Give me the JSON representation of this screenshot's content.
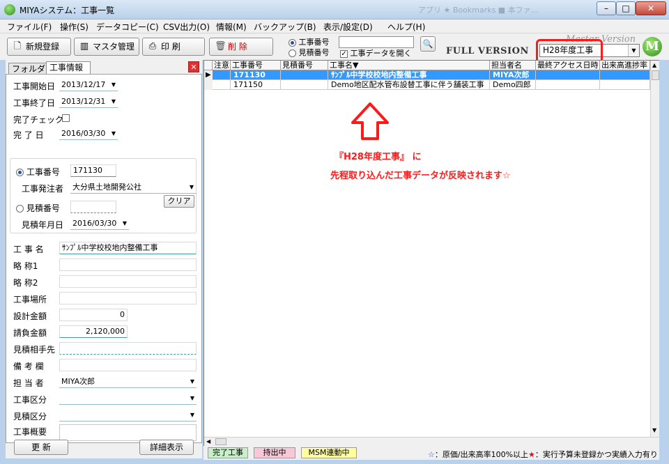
{
  "window": {
    "title": "MIYAシステム：工事一覧",
    "background_tabs": "アプリ  ★ Bookmarks  ■ 本ファ..."
  },
  "menu": [
    "ファイル(F)",
    "操作(S)",
    "データコピー(C)",
    "CSV出力(O)",
    "情報(M)",
    "バックアップ(B)",
    "表示/設定(D)",
    "ヘルプ(H)"
  ],
  "toolbar": {
    "new_label": "新規登録",
    "master_label": "マスタ管理",
    "print_label": "印 刷",
    "delete_label": "削 除",
    "radio_job_no": "工事番号",
    "radio_estimate_no": "見積番号",
    "open_data_label": "工事データを開く",
    "search_value": "",
    "full_version": "FULL VERSION",
    "master_version": "Master Version",
    "fiscal_year": "H28年度工事",
    "logo_letter": "M"
  },
  "tabs": {
    "folder": "フォルダ",
    "info": "工事情報"
  },
  "form": {
    "start_date_label": "工事開始日",
    "start_date": "2013/12/17",
    "end_date_label": "工事終了日",
    "end_date": "2013/12/31",
    "complete_check_label": "完了チェック",
    "complete_date_label": "完 了 日",
    "complete_date": "2016/03/30",
    "job_no_label": "工事番号",
    "job_no": "171130",
    "client_label": "工事発注者",
    "client": "大分県土地開発公社",
    "estimate_no_label": "見積番号",
    "estimate_no": "",
    "clear_label": "クリア",
    "estimate_date_label": "見積年月日",
    "estimate_date": "2016/03/30",
    "job_name_label": "工 事 名",
    "job_name": "ｻﾝﾌﾟﾙ中学校校地内整備工事",
    "abbr1_label": "略 称1",
    "abbr1": "",
    "abbr2_label": "略 称2",
    "abbr2": "",
    "site_label": "工事場所",
    "site": "",
    "design_amount_label": "設計金額",
    "design_amount": "0",
    "contract_amount_label": "請負金額",
    "contract_amount": "2,120,000",
    "estimate_client_label": "見積相手先",
    "estimate_client": "",
    "remarks_label": "備 考 欄",
    "remarks": "",
    "person_label": "担 当 者",
    "person": "MIYA次郎",
    "category_label": "工事区分",
    "category": "",
    "estimate_category_label": "見積区分",
    "estimate_category": "",
    "summary_label": "工事概要",
    "summary": "",
    "update_label": "更 新",
    "detail_label": "詳細表示"
  },
  "grid": {
    "columns": [
      "注意",
      "工事番号",
      "見積番号",
      "工事名▼",
      "担当者名",
      "最終アクセス日時",
      "出来高進捗率"
    ],
    "rows": [
      [
        "",
        "171130",
        "",
        "ｻﾝﾌﾟﾙ中学校校地内整備工事",
        "MIYA次郎",
        "",
        ""
      ],
      [
        "",
        "171150",
        "",
        "Demo地区配水管布設替工事に伴う舗装工事",
        "Demo四郎",
        "",
        ""
      ]
    ]
  },
  "annotation": {
    "line1": "『H28年度工事』 に",
    "line2": "先程取り込んだ工事データが反映されます☆"
  },
  "status": {
    "complete": "完了工事",
    "carry": "持出中",
    "msm": "MSM連動中",
    "legend_blue": "：原価/出来高率100%以上",
    "legend_red": "：実行予算未登録かつ実績入力有り"
  }
}
